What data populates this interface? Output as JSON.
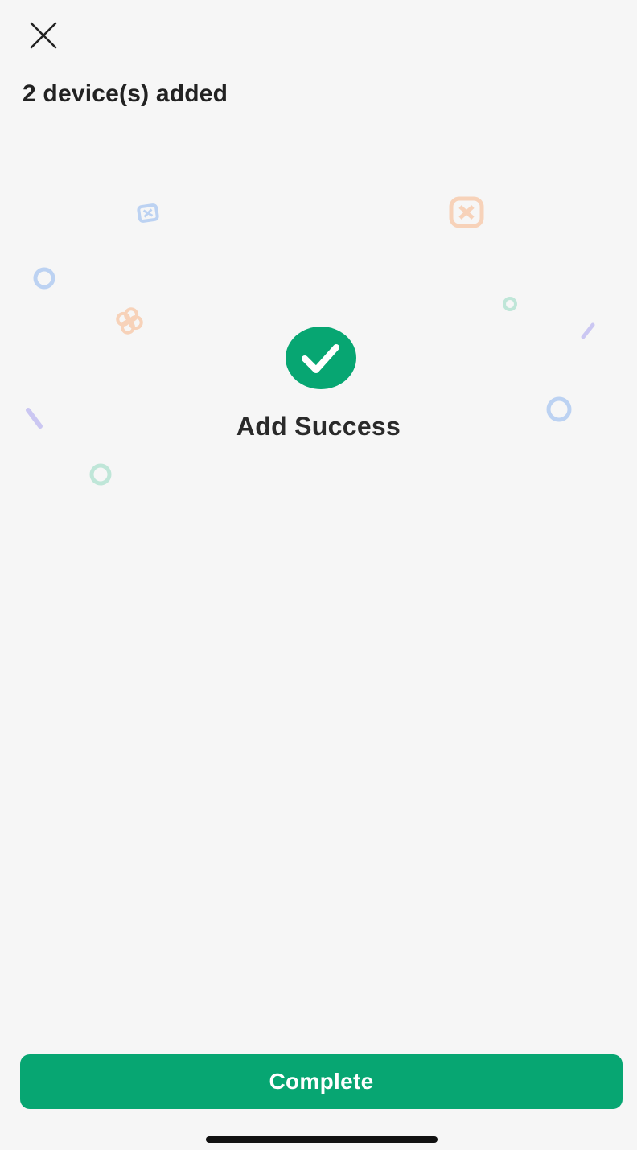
{
  "colors": {
    "accent": "#07a672",
    "background": "#f6f6f6",
    "confetti_blue": "#bcd2f2",
    "confetti_orange": "#f7d2b9",
    "confetti_green": "#bfe6d8",
    "confetti_purple": "#cbc7f2"
  },
  "header": {
    "close_icon": "close-icon",
    "title": "2 device(s) added"
  },
  "status": {
    "icon": "check-circle-icon",
    "message": "Add Success"
  },
  "footer": {
    "complete_label": "Complete"
  }
}
